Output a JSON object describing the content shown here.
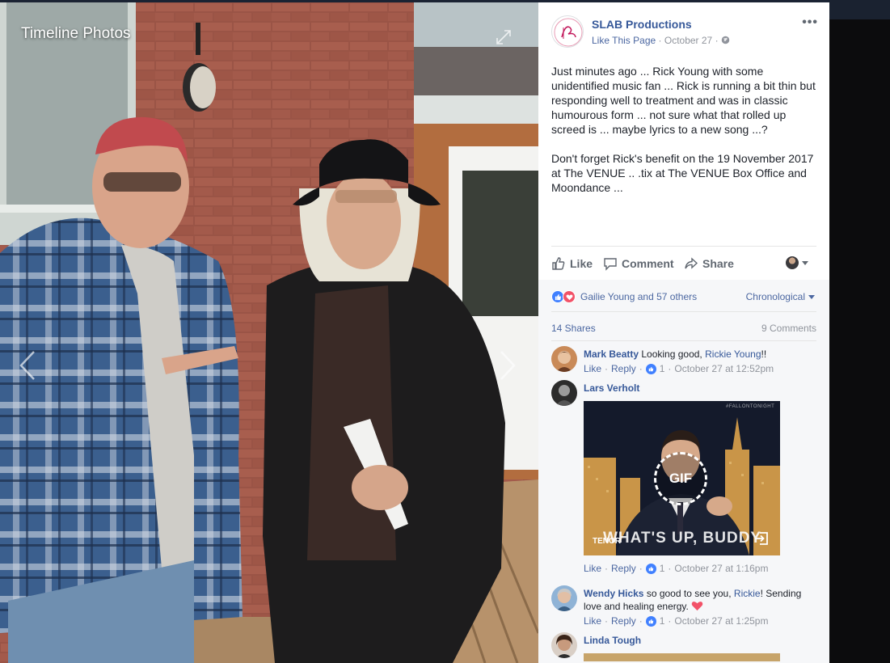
{
  "viewer": {
    "title": "Timeline Photos"
  },
  "post": {
    "page_name": "SLAB Productions",
    "like_page": "Like This Page",
    "date": "October 27",
    "paragraphs": [
      "Just minutes ago ... Rick Young with some unidentified music fan ... Rick is running a bit thin but responding well to treatment and was in classic humourous form ... not sure what that rolled up screed is ... maybe lyrics to a new song ...?",
      "Don't forget Rick's benefit on the 19 November 2017 at The VENUE .. .tix at The VENUE Box Office and Moondance ..."
    ],
    "actions": {
      "like": "Like",
      "comment": "Comment",
      "share": "Share"
    }
  },
  "reactions": {
    "summary": "Gailie Young and 57 others",
    "order": "Chronological",
    "shares": "14 Shares",
    "comments": "9 Comments"
  },
  "comments": [
    {
      "author": "Mark Beatty",
      "text": " Looking good, ",
      "mention": "Rickie Young",
      "text_after": "!!",
      "like": "Like",
      "reply": "Reply",
      "likes": "1",
      "time": "October 27 at 12:52pm"
    },
    {
      "author": "Lars Verholt",
      "gif_label": "GIF",
      "gif_caption": "WHAT'S UP, BUDDY",
      "gif_source": "TENOR",
      "gif_show": "#FALLONTONIGHT",
      "like": "Like",
      "reply": "Reply",
      "likes": "1",
      "time": "October 27 at 1:16pm"
    },
    {
      "author": "Wendy Hicks",
      "text": " so good to see you, ",
      "mention": "Rickie",
      "text_after": "! Sending love and healing energy. ",
      "like": "Like",
      "reply": "Reply",
      "likes": "1",
      "time": "October 27 at 1:25pm"
    },
    {
      "author": "Linda Tough"
    }
  ],
  "colors": {
    "link": "#365899",
    "meta": "#90949c",
    "like_blue": "#4080ff",
    "love_red": "#f25268"
  }
}
